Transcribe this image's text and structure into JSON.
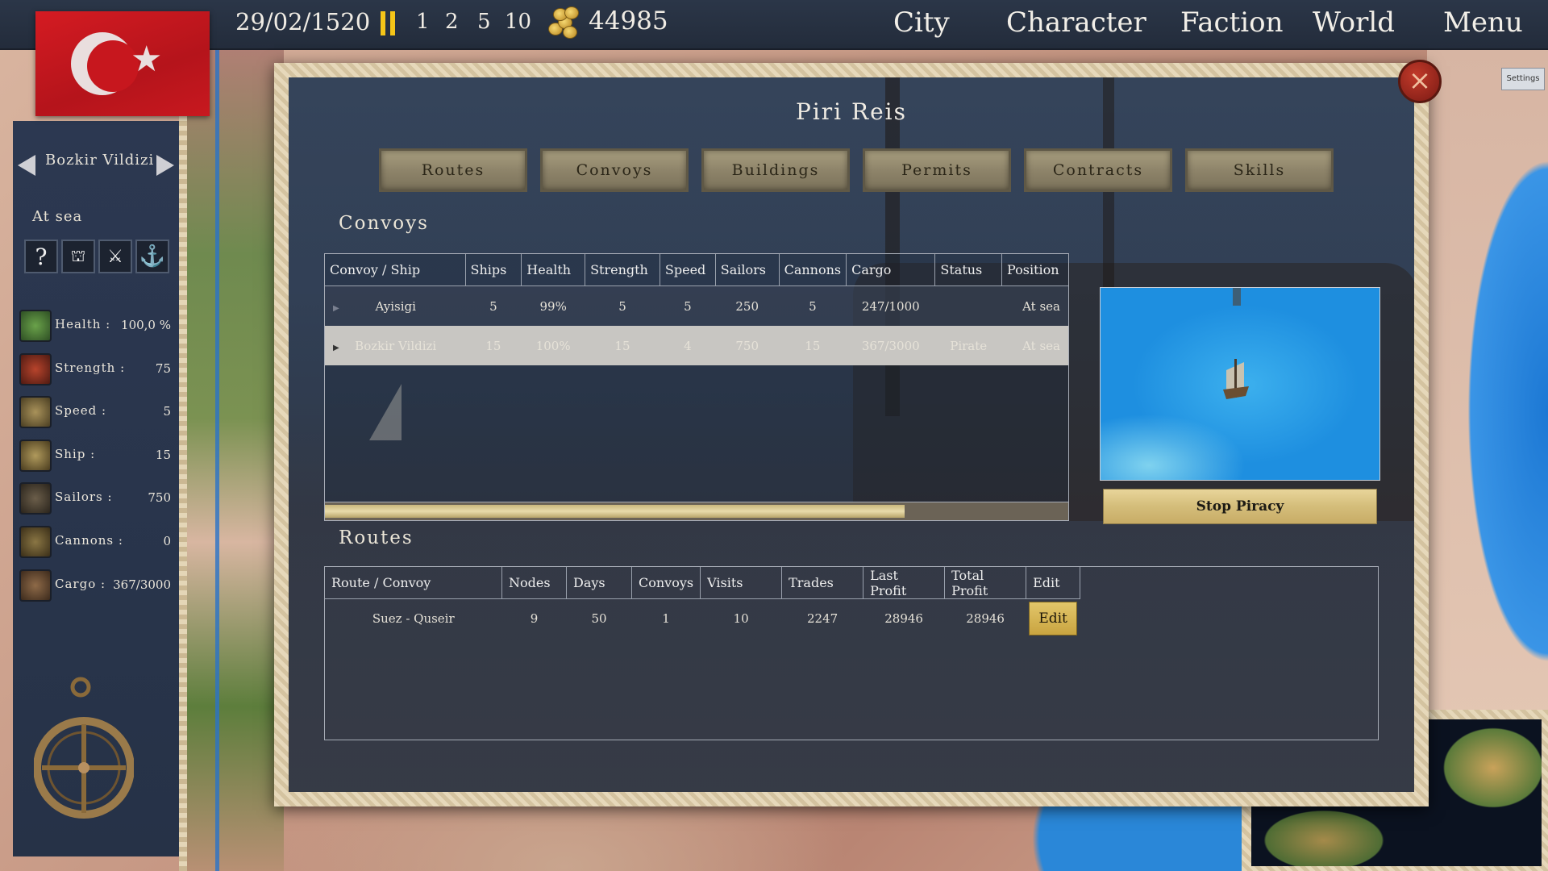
{
  "topbar": {
    "date": "29/02/1520",
    "speeds": [
      "1",
      "2",
      "5",
      "10"
    ],
    "gold": "44985",
    "nav": [
      "City",
      "Character",
      "Faction",
      "World",
      "Menu"
    ]
  },
  "sidebar": {
    "ship_name": "Bozkir Vildizi",
    "status": "At sea",
    "actions": [
      "help-icon",
      "city-icon",
      "combat-icon",
      "anchor-icon"
    ],
    "stats": [
      {
        "label": "Health :",
        "value": "100,0 %",
        "icon_color": "#3d6a35"
      },
      {
        "label": "Strength :",
        "value": "75",
        "icon_color": "#7a2a1e"
      },
      {
        "label": "Speed :",
        "value": "5",
        "icon_color": "#6e5f38"
      },
      {
        "label": "Ship :",
        "value": "15",
        "icon_color": "#6b5a30"
      },
      {
        "label": "Sailors :",
        "value": "750",
        "icon_color": "#4a4034"
      },
      {
        "label": "Cannons :",
        "value": "0",
        "icon_color": "#5a4a2e"
      },
      {
        "label": "Cargo :",
        "value": "367/3000",
        "icon_color": "#5c4530"
      }
    ]
  },
  "dialog": {
    "title": "Piri Reis",
    "tabs": [
      "Routes",
      "Convoys",
      "Buildings",
      "Permits",
      "Contracts",
      "Skills"
    ],
    "convoys_title": "Convoys",
    "routes_title": "Routes",
    "settings_label": "Settings",
    "stop_piracy_label": "Stop Piracy",
    "convoy_progress": 0.78
  },
  "convoys_table": {
    "headers": [
      "Convoy / Ship",
      "Ships",
      "Health",
      "Strength",
      "Speed",
      "Sailors",
      "Cannons",
      "Cargo",
      "Status",
      "Position"
    ],
    "rows": [
      [
        "Ayisigi",
        "5",
        "99%",
        "5",
        "5",
        "250",
        "5",
        "247/1000",
        "",
        "At sea"
      ],
      [
        "Bozkir Vildizi",
        "15",
        "100%",
        "15",
        "4",
        "750",
        "15",
        "367/3000",
        "Pirate",
        "At sea"
      ]
    ]
  },
  "routes_table": {
    "headers": [
      "Route / Convoy",
      "Nodes",
      "Days",
      "Convoys",
      "Visits",
      "Trades",
      "Last Profit",
      "Total Profit",
      "Edit"
    ],
    "rows": [
      [
        "Suez - Quseir",
        "9",
        "50",
        "1",
        "10",
        "2247",
        "28946",
        "28946"
      ]
    ],
    "edit_label": "Edit"
  },
  "colors": {
    "panel": "#2b3648",
    "gold_accent": "#f5c518",
    "flag_red": "#c8181f",
    "sea_blue": "#1e8fe0"
  }
}
